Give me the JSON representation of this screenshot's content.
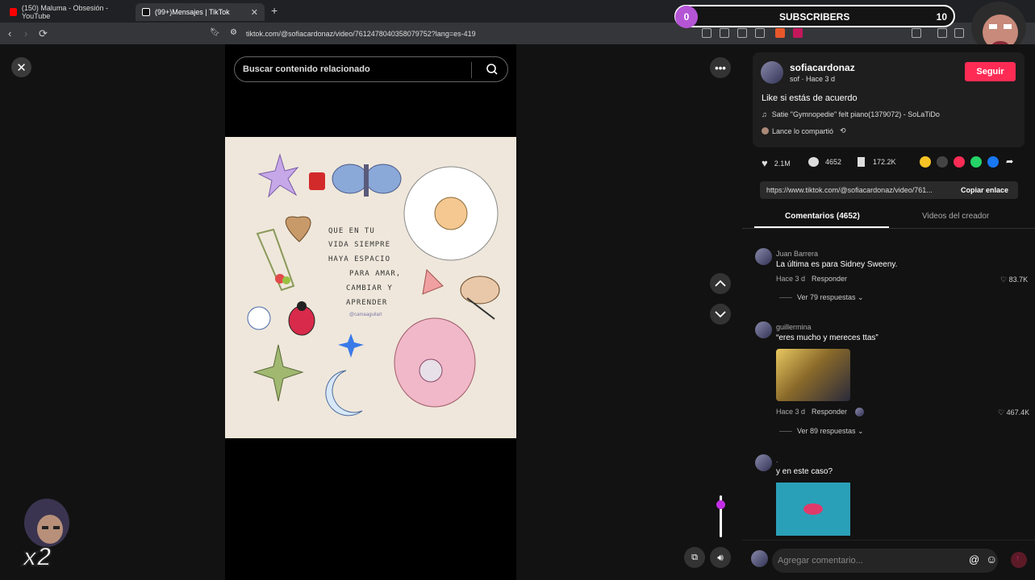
{
  "browser": {
    "tabs": [
      {
        "title": "(150) Maluma - Obsesión - YouTube",
        "color": "#ff0000"
      },
      {
        "title": "(99+)Mensajes | TikTok",
        "active": true
      }
    ],
    "url": "tiktok.com/@sofiacardonaz/video/7612478040358079752?lang=es-419"
  },
  "overlay": {
    "subscribers_label": "SUBSCRIBERS",
    "subscribers_current": "0",
    "subscribers_goal": "10",
    "multiplier": "x2"
  },
  "video": {
    "search_placeholder": "Buscar contenido relacionado",
    "art_text": [
      "QUE EN TU",
      "VIDA SIEMPRE",
      "HAYA ESPACIO",
      "PARA AMAR,",
      "CAMBIAR Y",
      "APRENDER"
    ],
    "art_signature": "@camaaguilart"
  },
  "post": {
    "username": "sofiacardonaz",
    "subline": "sof · Hace 3 d",
    "follow_label": "Seguir",
    "caption": "Like si estás de acuerdo",
    "music": "Satie \"Gymnopedie\" felt piano(1379072) - SoLaTiDo",
    "shared_by": "Lance lo compartió",
    "likes": "2.1M",
    "comments": "4652",
    "saves": "172.2K",
    "link": "https://www.tiktok.com/@sofiacardonaz/video/761...",
    "copy_label": "Copiar enlace"
  },
  "panel_tabs": {
    "comments": "Comentarios (4652)",
    "creator_videos": "Videos del creador"
  },
  "comments": [
    {
      "name": "Juan Barrera",
      "text": "La última es para Sidney Sweeny.",
      "time": "Hace 3 d",
      "reply": "Responder",
      "likes": "83.7K",
      "replies": "Ver 79 respuestas"
    },
    {
      "name": "guillermina⁣⁣",
      "text": "“eres mucho y mereces ttas”",
      "time": "Hace 3 d",
      "reply": "Responder",
      "likes": "467.4K",
      "replies": "Ver 89 respuestas"
    },
    {
      "name": ".",
      "text": "y en este caso?"
    }
  ],
  "comment_input": {
    "placeholder": "Agregar comentario..."
  },
  "colors": {
    "accent": "#fe2c55",
    "subs_circle": "#b455d6",
    "volume_knob": "#c22fe6"
  }
}
